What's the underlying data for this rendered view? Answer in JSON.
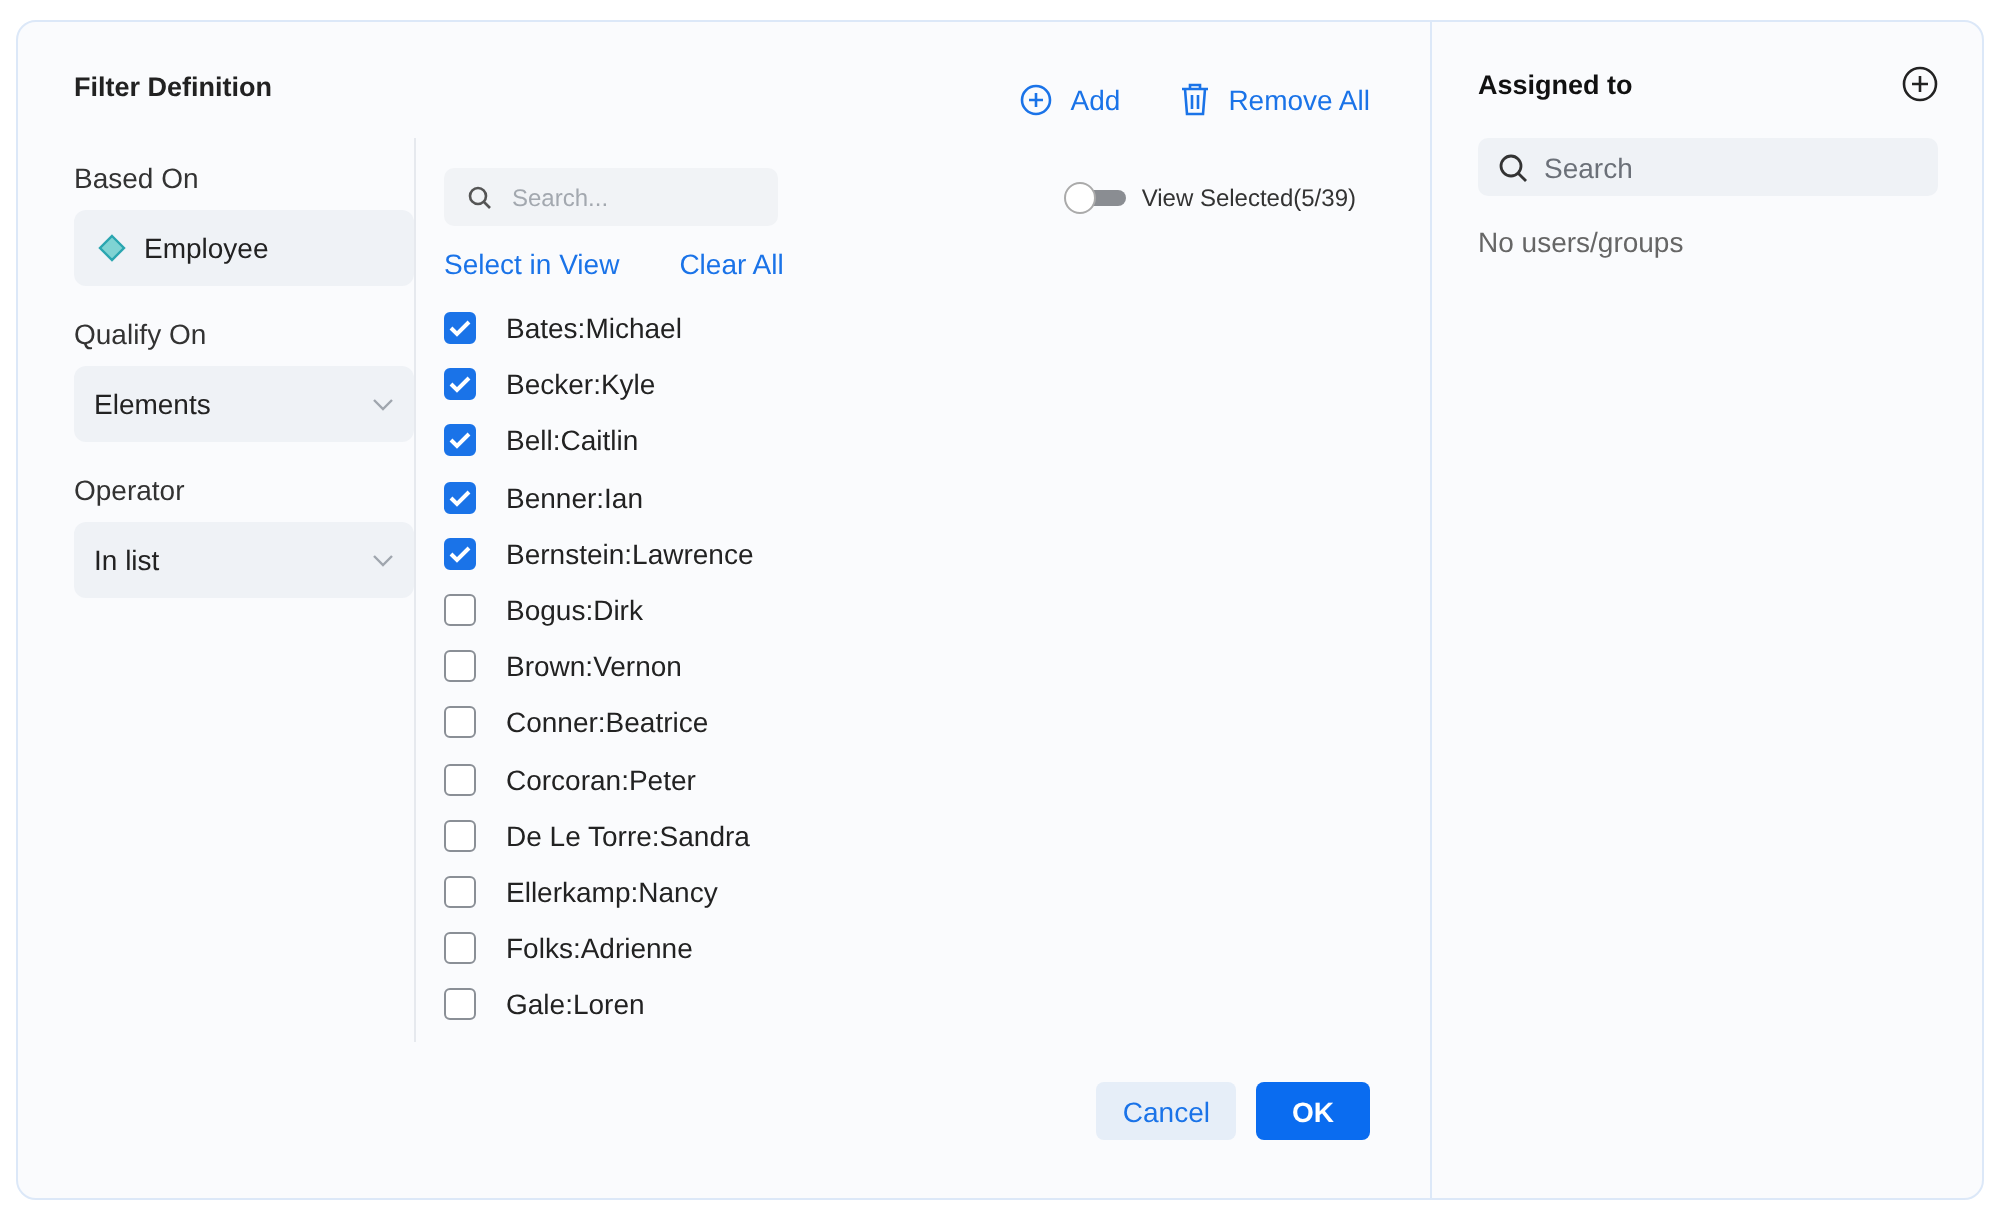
{
  "filter": {
    "title": "Filter Definition",
    "actions": [
      {
        "kind": "add",
        "label": "Add"
      },
      {
        "kind": "remove",
        "label": "Remove All"
      }
    ]
  },
  "fields": [
    {
      "label": "Based On",
      "kind": "entity",
      "value": "Employee"
    },
    {
      "label": "Qualify On",
      "kind": "dropdown",
      "value": "Elements"
    },
    {
      "label": "Operator",
      "kind": "dropdown",
      "value": "In list"
    }
  ],
  "list": {
    "search": {
      "placeholder": "Search..."
    },
    "view_selected": {
      "on": false,
      "label": "View Selected(5/39)"
    },
    "links": [
      "Select in View",
      "Clear All"
    ],
    "items": [
      {
        "label": "Bates:Michael",
        "checked": true
      },
      {
        "label": "Becker:Kyle",
        "checked": true
      },
      {
        "label": "Bell:Caitlin",
        "checked": true
      },
      {
        "label": "Benner:Ian",
        "checked": true
      },
      {
        "label": "Bernstein:Lawrence",
        "checked": true
      },
      {
        "label": "Bogus:Dirk",
        "checked": false
      },
      {
        "label": "Brown:Vernon",
        "checked": false
      },
      {
        "label": "Conner:Beatrice",
        "checked": false
      },
      {
        "label": "Corcoran:Peter",
        "checked": false
      },
      {
        "label": "De Le Torre:Sandra",
        "checked": false
      },
      {
        "label": "Ellerkamp:Nancy",
        "checked": false
      },
      {
        "label": "Folks:Adrienne",
        "checked": false
      },
      {
        "label": "Gale:Loren",
        "checked": false
      }
    ]
  },
  "buttons": [
    {
      "kind": "secondary",
      "label": "Cancel"
    },
    {
      "kind": "primary",
      "label": "OK"
    }
  ],
  "assigned": {
    "title": "Assigned to",
    "search": {
      "placeholder": "Search"
    },
    "empty": "No users/groups"
  }
}
